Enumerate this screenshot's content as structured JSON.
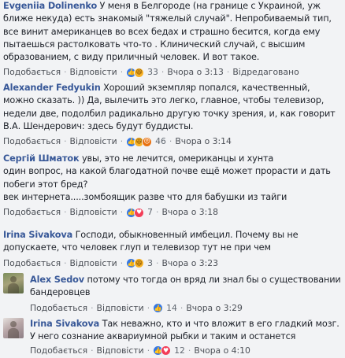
{
  "comments": [
    {
      "author": "Evgeniia Dolinenko",
      "text": "У меня в Белгороде (на границе с Украиной, уж ближе некуда) есть знакомый \"тяжелый случай\". Непробиваемый тип, все винит американцев во всех бедах и страшно бесится, когда ему пытаешься растолковать что-то . Клинический случай, с высшим образованием, с виду приличный человек. И вот такое.",
      "like": "Подобається",
      "reply": "Відповісти",
      "reactions": [
        "like-icon",
        "haha-icon"
      ],
      "count": "33",
      "time": "Вчора о 3:13",
      "extra": "Відредаговано"
    },
    {
      "author": "Alexander Fedyukin",
      "text": "Хороший экземпляр попался, качественный, можно сказать. )) Да, вылечить это легко, главное, чтобы телевизор, недели две, подолбил радикально другую точку зрения, и, как говорит В.А. Шендерович: здесь будут буддисты.",
      "like": "Подобається",
      "reply": "Відповісти",
      "reactions": [
        "like-icon",
        "haha-icon",
        "angry-icon"
      ],
      "count": "46",
      "time": "Вчора о 3:14"
    },
    {
      "author": "Сергій Шматок",
      "text_lines": [
        "увы, это не лечится, омериканцы и хунта",
        "один вопрос, на какой благодатной почве ещё может прорасти и дать побеги этот бред?",
        "век интернета.....зомбоящик разве что для бабушки из тайги"
      ],
      "like": "Подобається",
      "reply": "Відповісти",
      "reactions": [
        "like-icon",
        "love-icon"
      ],
      "count": "7",
      "time": "Вчора о 3:18"
    },
    {
      "author": "Irina Sivakova",
      "text": "Господи, обыкновенный имбецил. Почему вы не допускаете, что человек глуп и телевизор тут не при чем",
      "like": "Подобається",
      "reply": "Відповісти",
      "reactions": [
        "like-icon",
        "haha-icon"
      ],
      "count": "3",
      "time": "Вчора о 3:23"
    },
    {
      "author": "Alex Sedov",
      "text": "потому что тогда он вряд ли знал бы о существовании бандеровцев",
      "like": "Подобається",
      "reply": "Відповісти",
      "reactions": [
        "like-icon"
      ],
      "count": "14",
      "time": "Вчора о 3:29"
    },
    {
      "author": "Irina Sivakova",
      "text": "Так неважно, кто и что вложит в его гладкий мозг. У него сознание аквариумной рыбки и таким и останется",
      "like": "Подобається",
      "reply": "Відповісти",
      "reactions": [
        "like-icon",
        "love-icon"
      ],
      "count": "12",
      "time": "Вчора о 4:10"
    }
  ],
  "colors": {
    "background": "#f2f3f5",
    "author": "#385898",
    "text": "#1d2129",
    "meta": "#606770",
    "like_reaction": "#3578e5",
    "haha_reaction": "#f7b125",
    "angry_reaction": "#e9710f",
    "love_reaction": "#f33e58"
  }
}
